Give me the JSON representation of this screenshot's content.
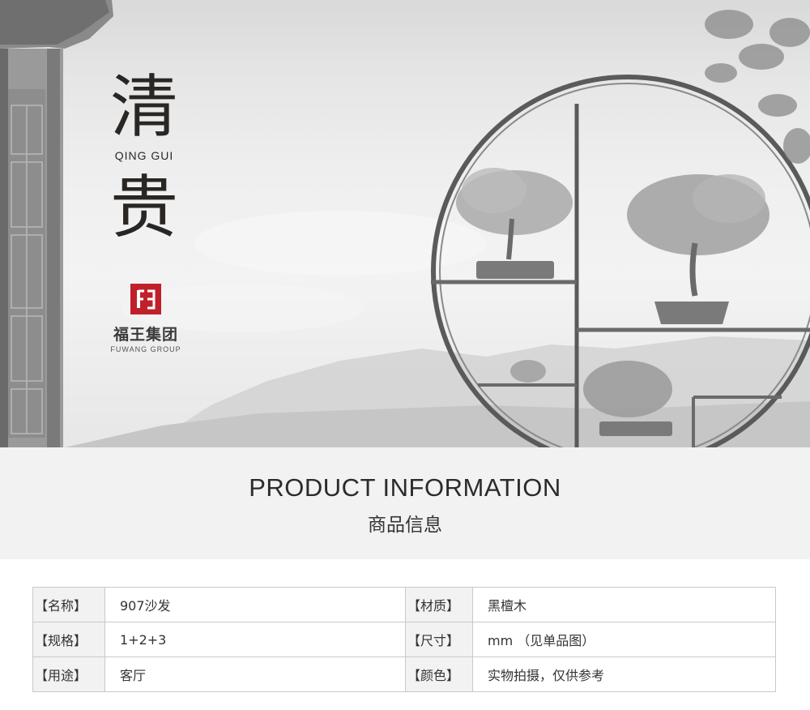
{
  "hero": {
    "title_char_1": "清",
    "pinyin": "QING GUI",
    "title_char_2": "贵",
    "logo_name": "福王集团",
    "logo_sub": "FUWANG GROUP"
  },
  "section": {
    "title_en": "PRODUCT INFORMATION",
    "title_cn": "商品信息"
  },
  "product_info": {
    "rows": [
      {
        "label_left": "【名称】",
        "value_left": "907沙发",
        "label_right": "【材质】",
        "value_right": "黑檀木"
      },
      {
        "label_left": "【规格】",
        "value_left": "1+2+3",
        "label_right": "【尺寸】",
        "value_right": "mm （见单品图）"
      },
      {
        "label_left": "【用途】",
        "value_left": "客厅",
        "label_right": "【颜色】",
        "value_right": "实物拍摄，仅供参考"
      }
    ]
  },
  "colors": {
    "logo_red": "#c0202a",
    "band_gray": "#f2f2f2",
    "text_dark": "#2a2624"
  }
}
